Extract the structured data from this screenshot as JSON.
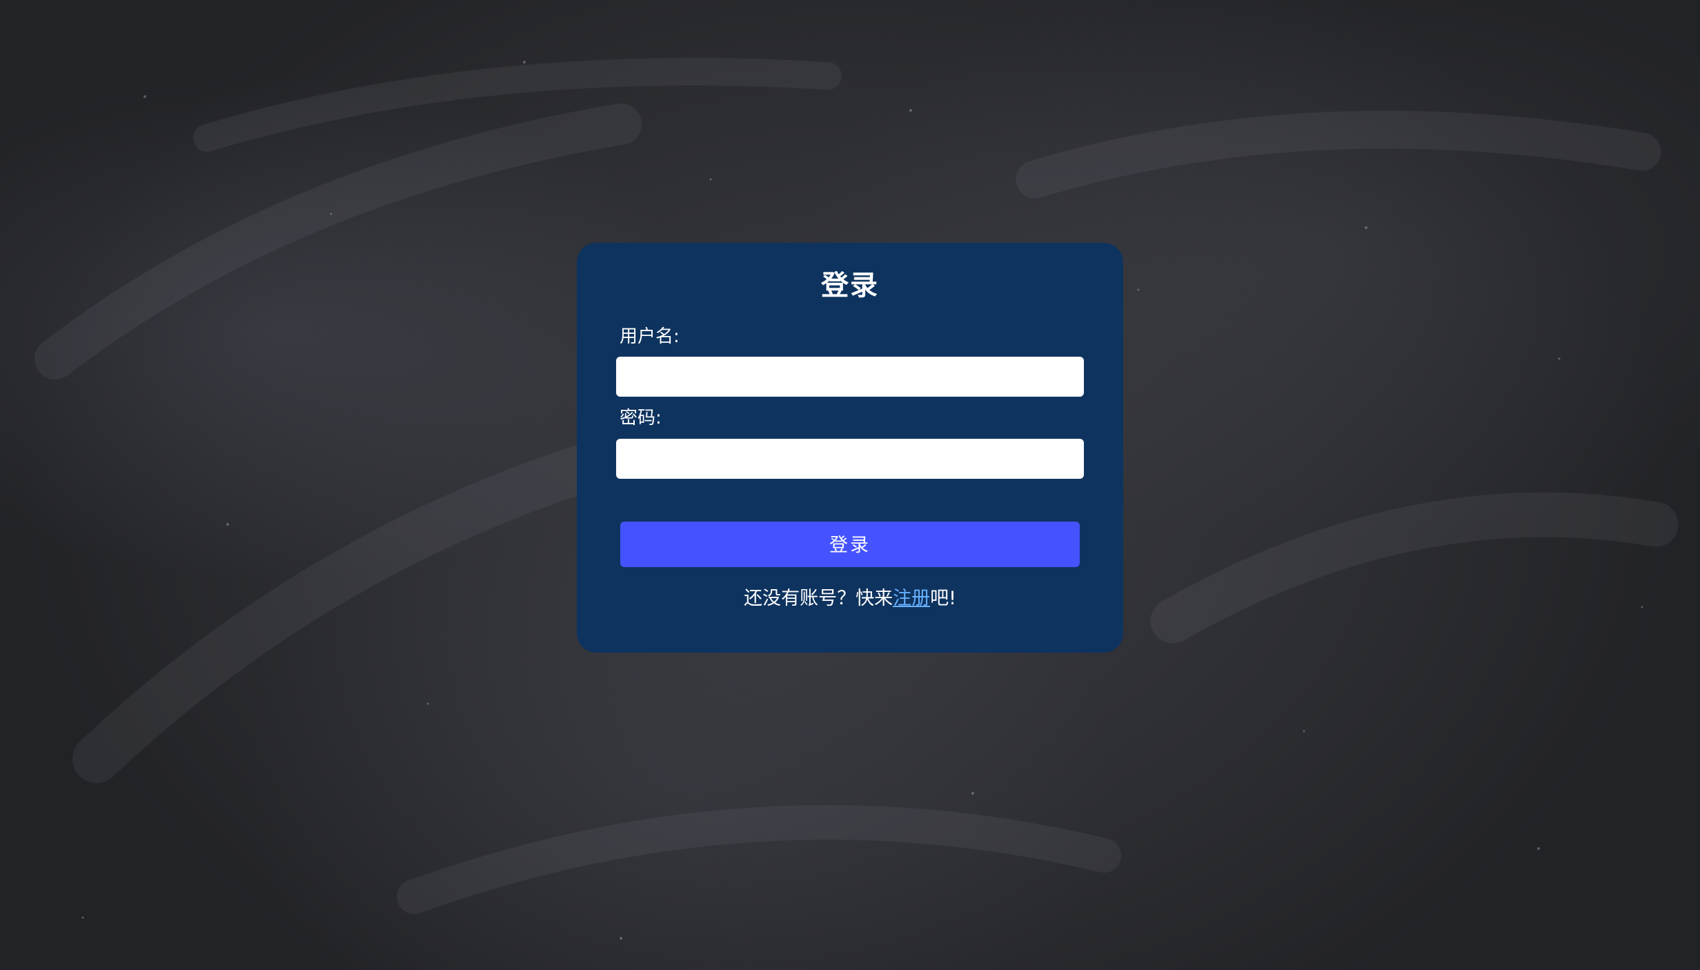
{
  "login": {
    "title": "登录",
    "username_label": "用户名:",
    "username_value": "",
    "password_label": "密码:",
    "password_value": "",
    "submit_label": "登录",
    "register_prefix": "还没有账号？快来",
    "register_link": "注册",
    "register_suffix": "吧!"
  },
  "colors": {
    "background": "#2e2f34",
    "card": "#0e335f",
    "button": "#4452ff",
    "link": "#67b2ff"
  }
}
